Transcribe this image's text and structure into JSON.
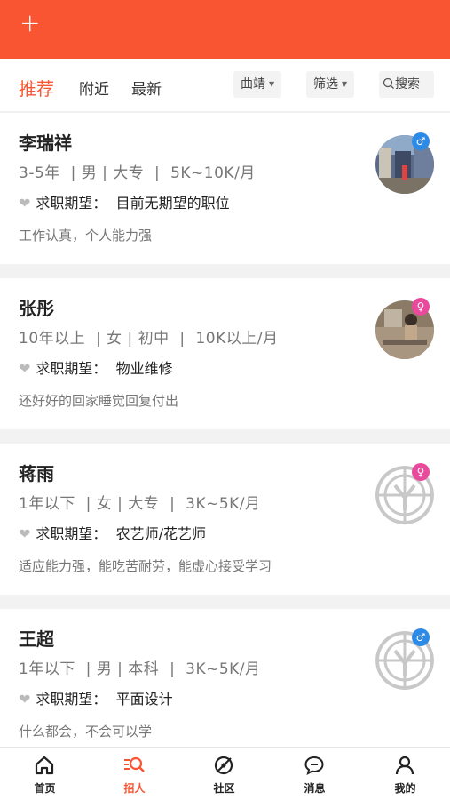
{
  "topbar": {
    "add_icon": "plus-icon",
    "color": "#fa5533"
  },
  "tabs": {
    "recommend": "推荐",
    "nearby": "附近",
    "latest": "最新",
    "city": "曲靖",
    "filter": "筛选",
    "search": "搜索"
  },
  "candidates": [
    {
      "name": "李瑞祥",
      "meta": "3-5年  | 男 | 大专  |  5K~10K/月",
      "expect_label": "求职期望：",
      "expect_value": "目前无期望的职位",
      "desc": "工作认真，个人能力强",
      "gender": "male",
      "avatar": "photo"
    },
    {
      "name": "张彤",
      "meta": "10年以上  | 女 | 初中  |  10K以上/月",
      "expect_label": "求职期望：",
      "expect_value": "物业维修",
      "desc": "还好好的回家睡觉回复付出",
      "gender": "female",
      "avatar": "photo"
    },
    {
      "name": "蒋雨",
      "meta": "1年以下  | 女 | 大专  |  3K~5K/月",
      "expect_label": "求职期望：",
      "expect_value": "农艺师/花艺师",
      "desc": "适应能力强，能吃苦耐劳，能虚心接受学习",
      "gender": "female",
      "avatar": "default"
    },
    {
      "name": "王超",
      "meta": "1年以下  | 男 | 本科  |  3K~5K/月",
      "expect_label": "求职期望：",
      "expect_value": "平面设计",
      "desc": "什么都会，不会可以学",
      "gender": "male",
      "avatar": "default"
    }
  ],
  "nav": {
    "home": "首页",
    "recruit": "招人",
    "community": "社区",
    "messages": "消息",
    "mine": "我的",
    "active_color": "#fa5533"
  }
}
